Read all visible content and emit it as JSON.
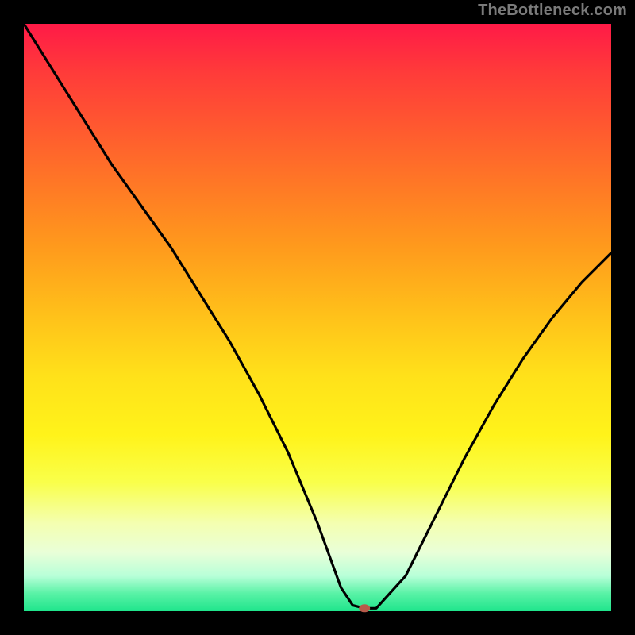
{
  "watermark": "TheBottleneck.com",
  "colors": {
    "background": "#000000",
    "curve_stroke": "#000000",
    "dot_fill": "#b85a4a",
    "watermark_text": "#7a7a7a"
  },
  "chart_data": {
    "type": "line",
    "title": "",
    "xlabel": "",
    "ylabel": "",
    "xlim": [
      0,
      100
    ],
    "ylim": [
      0,
      100
    ],
    "grid": false,
    "legend": false,
    "series": [
      {
        "name": "bottleneck-curve",
        "x": [
          0,
          5,
          10,
          15,
          20,
          25,
          30,
          35,
          40,
          45,
          50,
          54,
          56,
          58,
          60,
          65,
          70,
          75,
          80,
          85,
          90,
          95,
          100
        ],
        "values": [
          100,
          92,
          84,
          76,
          69,
          62,
          54,
          46,
          37,
          27,
          15,
          4,
          1,
          0.5,
          0.5,
          6,
          16,
          26,
          35,
          43,
          50,
          56,
          61
        ]
      }
    ],
    "annotations": [
      {
        "name": "optimum-dot",
        "x": 58,
        "y": 0.5
      }
    ],
    "background_gradient": {
      "top": "#ff1a47",
      "middle": "#ffe11a",
      "bottom": "#1fe58c"
    }
  }
}
